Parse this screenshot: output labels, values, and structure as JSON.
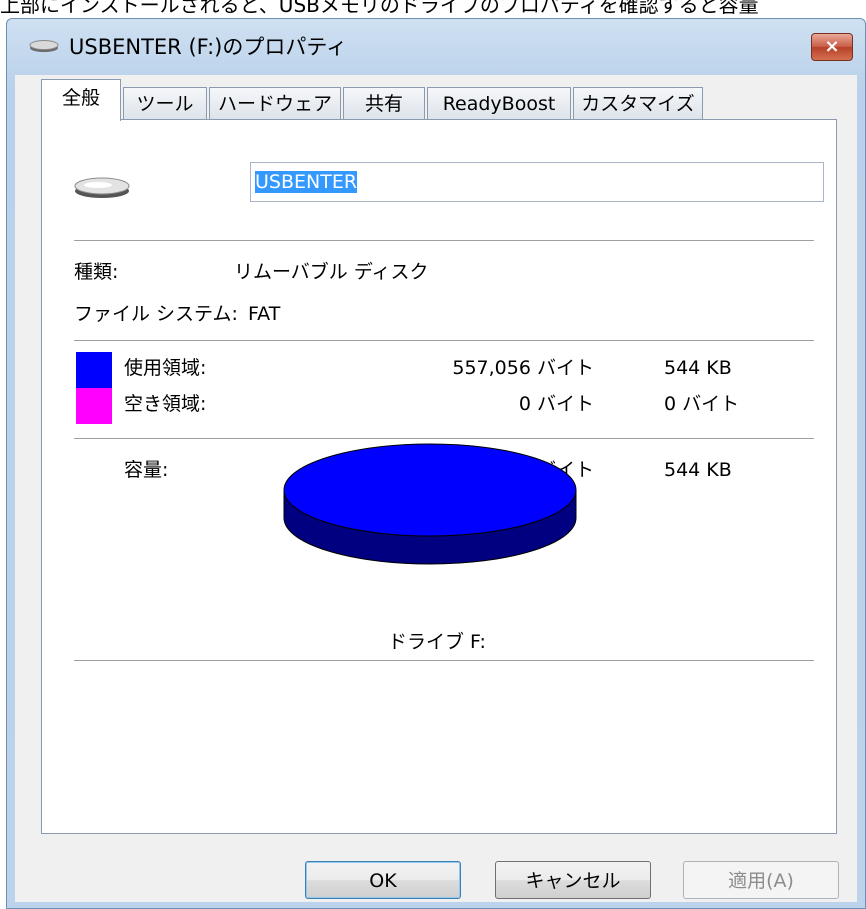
{
  "caption": "上部にインストールされると、USBメモリのドライブのプロパティを確認すると容量",
  "window": {
    "title": "USBENTER (F:)のプロパティ",
    "close_label": "×"
  },
  "tabs": [
    {
      "label": "全般",
      "active": true
    },
    {
      "label": "ツール",
      "active": false
    },
    {
      "label": "ハードウェア",
      "active": false
    },
    {
      "label": "共有",
      "active": false
    },
    {
      "label": "ReadyBoost",
      "active": false
    },
    {
      "label": "カスタマイズ",
      "active": false
    }
  ],
  "general": {
    "drive_name": "USBENTER",
    "type_label": "種類:",
    "type_value": "リムーバブル ディスク",
    "fs_label": "ファイル システム:",
    "fs_value": "FAT",
    "used": {
      "label": "使用領域:",
      "bytes": "557,056 バイト",
      "size": "544 KB",
      "color": "#0000ff"
    },
    "free": {
      "label": "空き領域:",
      "bytes": "0 バイト",
      "size": "0 バイト",
      "color": "#ff00ff"
    },
    "capacity": {
      "label": "容量:",
      "bytes": "557,056 バイト",
      "size": "544 KB"
    },
    "drive_caption": "ドライブ F:"
  },
  "chart_data": {
    "type": "pie",
    "series": [
      {
        "name": "使用領域",
        "value": 557056,
        "color": "#0000ff"
      },
      {
        "name": "空き領域",
        "value": 0,
        "color": "#ff00ff"
      }
    ]
  },
  "buttons": {
    "ok": "OK",
    "cancel": "キャンセル",
    "apply": "適用(A)"
  },
  "icons": {
    "title": "drive-icon",
    "close": "close-icon",
    "drive": "removable-drive-icon"
  }
}
